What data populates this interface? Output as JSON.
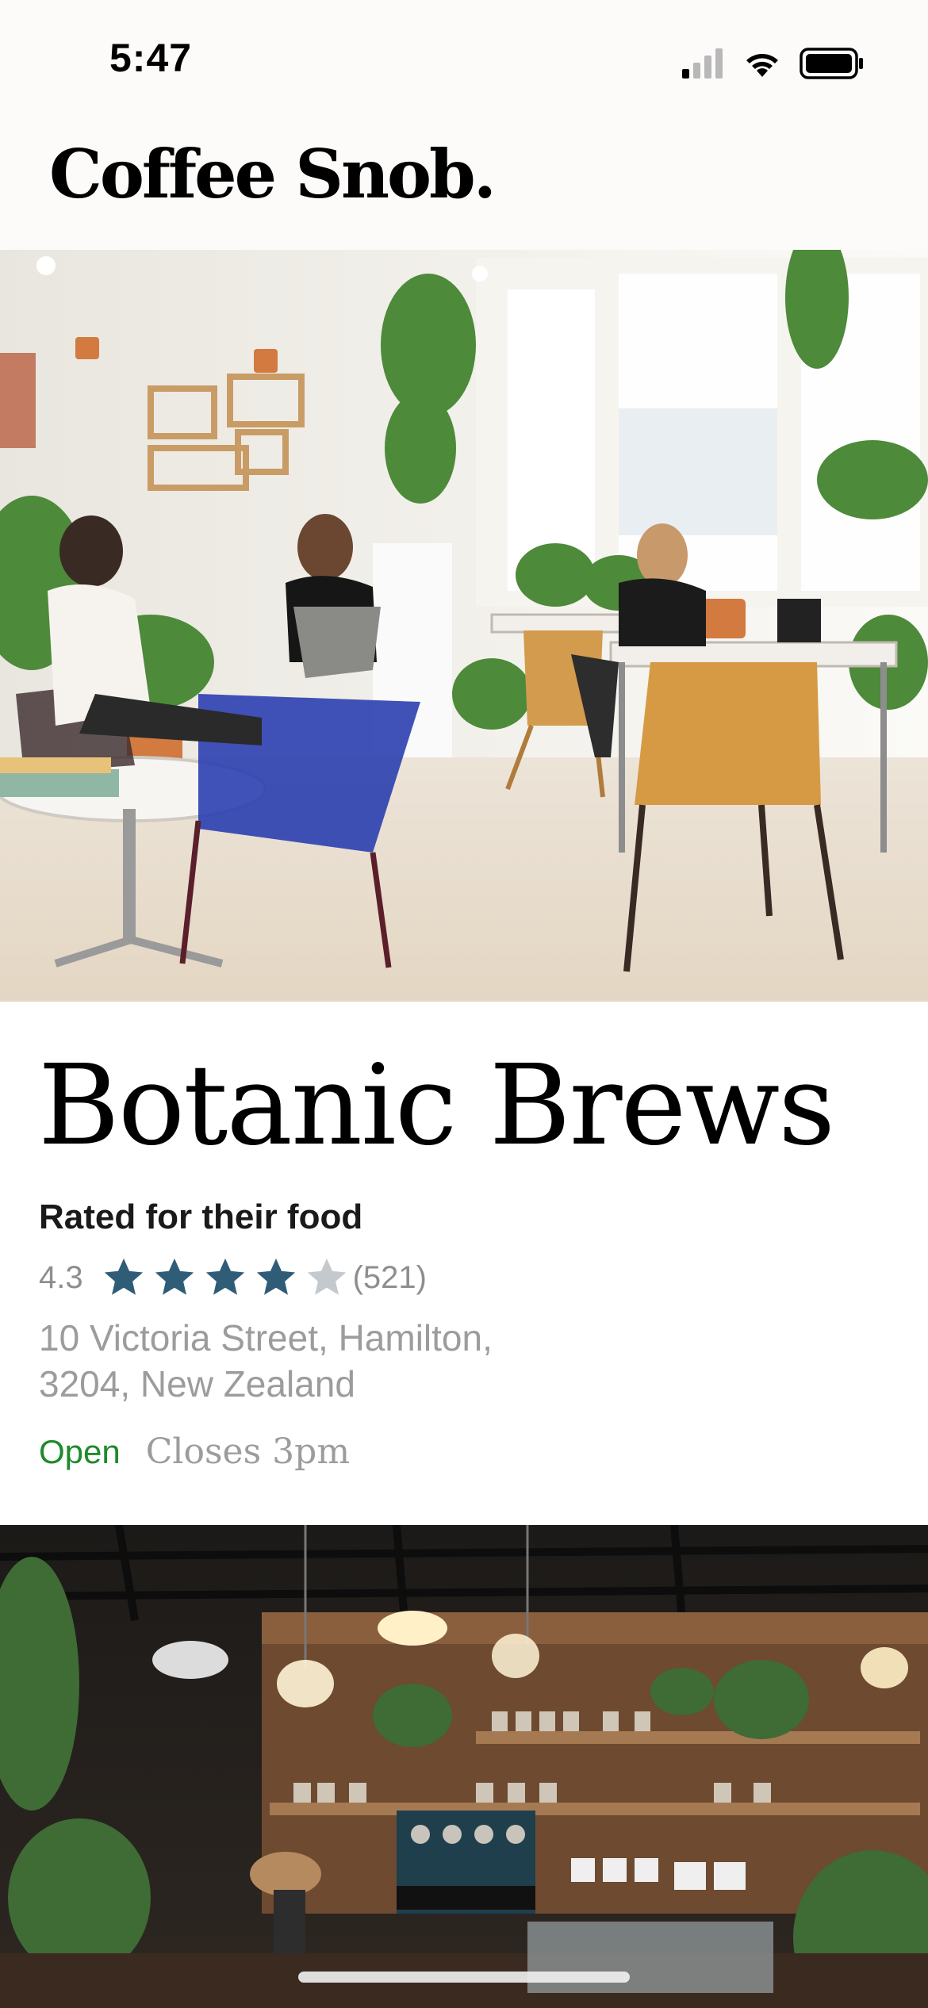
{
  "status_bar": {
    "time": "5:47"
  },
  "header": {
    "title": "Coffee Snob."
  },
  "cafe": {
    "name": "Botanic Brews",
    "rated_for": "Rated for their food",
    "rating": "4.3",
    "stars_filled": 4,
    "stars_total": 5,
    "review_count": "(521)",
    "address_line1": "10 Victoria Street, Hamilton,",
    "address_line2": "3204, New Zealand",
    "open_status": "Open",
    "closes": "Closes 3pm"
  },
  "colors": {
    "background": "#fdfbf9",
    "star_filled": "#2f5d78",
    "star_empty": "#c4c9cd",
    "open_green": "#1f8a2b",
    "muted_text": "#9c9c9c"
  },
  "icons": {
    "status": [
      "signal-icon",
      "wifi-icon",
      "battery-icon"
    ],
    "rating": "star-icon"
  }
}
